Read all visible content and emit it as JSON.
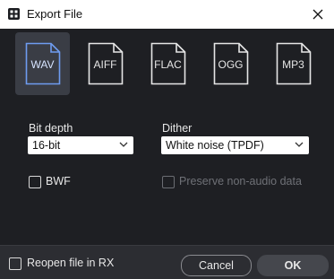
{
  "window": {
    "title": "Export File"
  },
  "formats": {
    "items": [
      {
        "label": "WAV",
        "selected": true
      },
      {
        "label": "AIFF",
        "selected": false
      },
      {
        "label": "FLAC",
        "selected": false
      },
      {
        "label": "OGG",
        "selected": false
      },
      {
        "label": "MP3",
        "selected": false
      }
    ]
  },
  "settings": {
    "bit_depth_label": "Bit depth",
    "bit_depth_value": "16-bit",
    "dither_label": "Dither",
    "dither_value": "White noise (TPDF)",
    "bwf_label": "BWF",
    "bwf_checked": false,
    "preserve_label": "Preserve non-audio data",
    "preserve_checked": false,
    "preserve_enabled": false
  },
  "footer": {
    "reopen_label": "Reopen file in RX",
    "reopen_checked": false,
    "cancel_label": "Cancel",
    "ok_label": "OK"
  },
  "colors": {
    "background": "#1e1f23",
    "selected_tile": "#3a3d45",
    "selected_outline": "#6e9cf0",
    "footer": "#2c2d32"
  }
}
